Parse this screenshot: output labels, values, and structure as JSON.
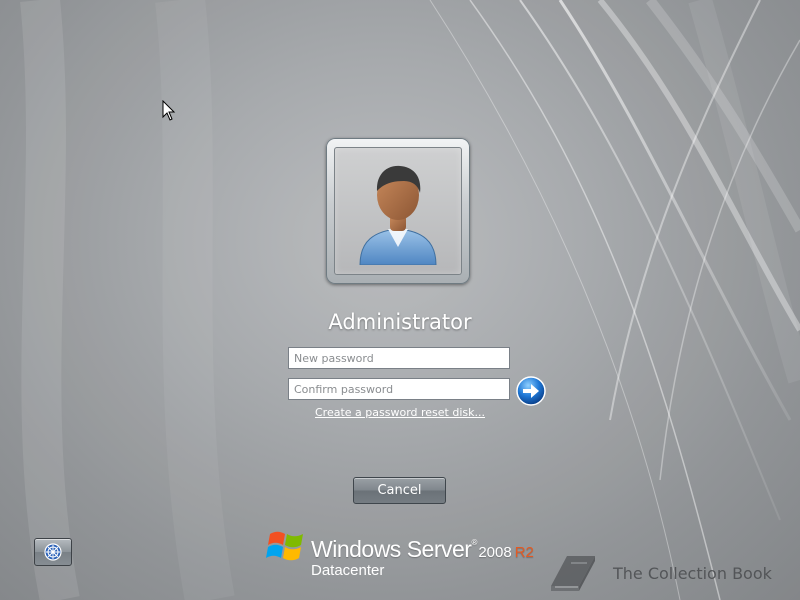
{
  "screen": {
    "background_colors": [
      "#b8babd",
      "#8e9194"
    ]
  },
  "user_tile": {
    "avatar_icon": "user-avatar-icon",
    "user_name": "Administrator"
  },
  "password_form": {
    "new_password_placeholder": "New password",
    "new_password_value": "",
    "confirm_password_placeholder": "Confirm password",
    "confirm_password_value": "",
    "submit_icon": "arrow-right-icon",
    "reset_link_label": "Create a password reset disk..."
  },
  "buttons": {
    "cancel_label": "Cancel",
    "ease_access_icon": "ease-of-access-icon"
  },
  "branding": {
    "product": "Windows Server",
    "trademark": "®",
    "version": "2008",
    "release": "R2",
    "edition": "Datacenter",
    "release_color": "#e35a23",
    "logo_icon": "windows-flag-icon"
  },
  "watermark": {
    "icon": "book-icon",
    "text": "The Collection Book"
  }
}
